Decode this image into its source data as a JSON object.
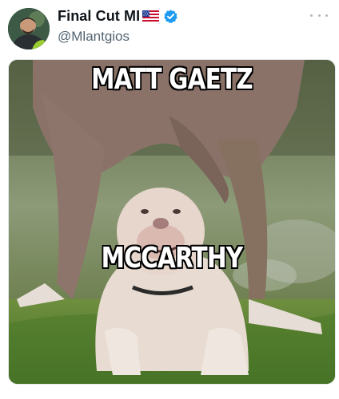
{
  "post": {
    "author": {
      "display_name": "Final Cut MI",
      "handle": "@Mlantgios",
      "flag": "us-flag-emoji",
      "verified_badge": "verified-check-icon"
    },
    "more_menu": "more-options-icon",
    "media": {
      "caption_top": "MATT GAETZ",
      "caption_bottom": "MCCARTHY"
    }
  },
  "colors": {
    "verified_blue": "#1d9bf0",
    "handle_gray": "#536471",
    "text": "#0f1419"
  }
}
